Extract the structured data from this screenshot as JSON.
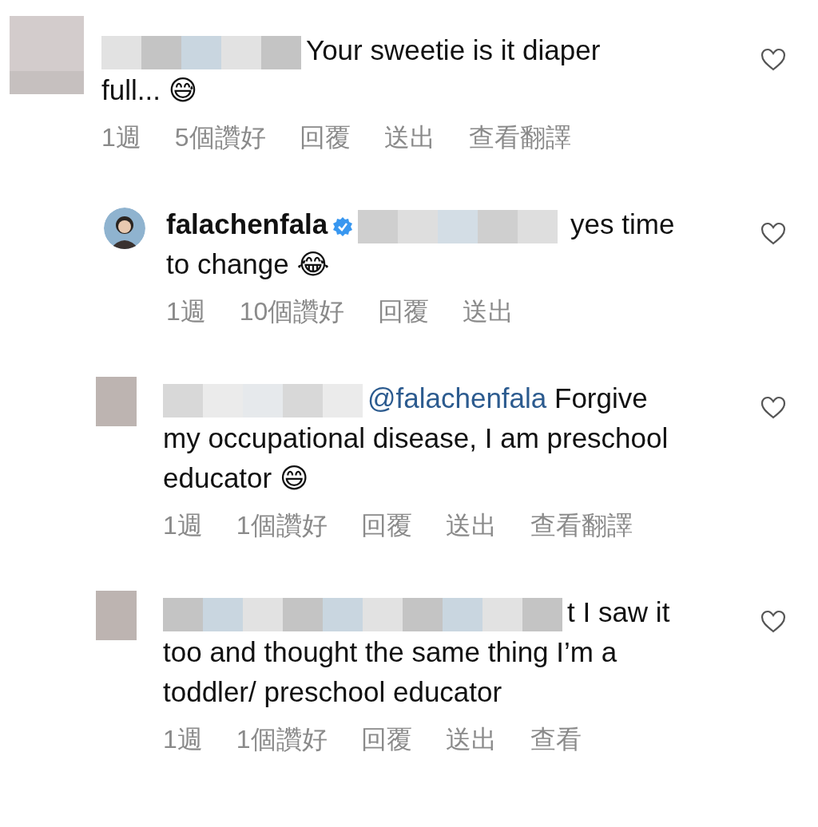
{
  "comments": [
    {
      "kind": "comment",
      "text": "Your sweetie is it diaper full... 😅",
      "meta": [
        "1週",
        "5個讚好",
        "回覆",
        "送出",
        "查看翻譯"
      ]
    },
    {
      "kind": "reply",
      "username": "falachenfala",
      "text": " yes time to change 😂",
      "meta": [
        "1週",
        "10個讚好",
        "回覆",
        "送出"
      ]
    },
    {
      "kind": "reply",
      "mention": "@falachenfala",
      "text": " Forgive my occupational disease, I am preschool educator 😄",
      "meta": [
        "1週",
        "1個讚好",
        "回覆",
        "送出",
        "查看翻譯"
      ]
    },
    {
      "kind": "reply",
      "text": "t I saw it too and thought the same thing I’m a toddler/ preschool educator",
      "meta": [
        "1週",
        "1個讚好",
        "回覆",
        "送出",
        "查看"
      ]
    }
  ]
}
